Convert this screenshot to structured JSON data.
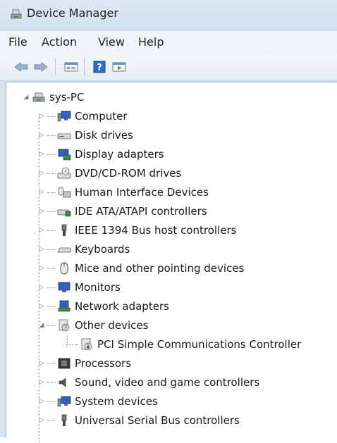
{
  "window": {
    "title": "Device Manager"
  },
  "menu": {
    "items": [
      "File",
      "Action",
      "View",
      "Help"
    ]
  },
  "toolbar": {
    "buttons": [
      "back-arrow-icon",
      "forward-arrow-icon",
      "properties-pane-icon",
      "help-icon",
      "show-hidden-icon"
    ]
  },
  "tree": {
    "root": "sys-PC",
    "items": [
      {
        "label": "Computer",
        "icon": "computer-icon",
        "expanded": false
      },
      {
        "label": "Disk drives",
        "icon": "disk-drive-icon",
        "expanded": false
      },
      {
        "label": "Display adapters",
        "icon": "display-adapter-icon",
        "expanded": false
      },
      {
        "label": "DVD/CD-ROM drives",
        "icon": "dvd-drive-icon",
        "expanded": false
      },
      {
        "label": "Human Interface Devices",
        "icon": "hid-icon",
        "expanded": false
      },
      {
        "label": "IDE ATA/ATAPI controllers",
        "icon": "ide-controller-icon",
        "expanded": false
      },
      {
        "label": "IEEE 1394 Bus host controllers",
        "icon": "ieee1394-icon",
        "expanded": false
      },
      {
        "label": "Keyboards",
        "icon": "keyboard-icon",
        "expanded": false
      },
      {
        "label": "Mice and other pointing devices",
        "icon": "mouse-icon",
        "expanded": false
      },
      {
        "label": "Monitors",
        "icon": "monitor-icon",
        "expanded": false
      },
      {
        "label": "Network adapters",
        "icon": "network-adapter-icon",
        "expanded": false
      },
      {
        "label": "Other devices",
        "icon": "unknown-device-icon",
        "expanded": true,
        "children": [
          {
            "label": "PCI Simple Communications Controller",
            "icon": "unknown-device-warning-icon"
          }
        ]
      },
      {
        "label": "Processors",
        "icon": "processor-icon",
        "expanded": false
      },
      {
        "label": "Sound, video and game controllers",
        "icon": "sound-icon",
        "expanded": false
      },
      {
        "label": "System devices",
        "icon": "system-device-icon",
        "expanded": false
      },
      {
        "label": "Universal Serial Bus controllers",
        "icon": "usb-icon",
        "expanded": false
      }
    ]
  },
  "colors": {
    "titlebar": "#dfe9f5",
    "menubar": "#f1f5fb",
    "content_bg": "#ffffff",
    "text": "#1a1a1a"
  }
}
